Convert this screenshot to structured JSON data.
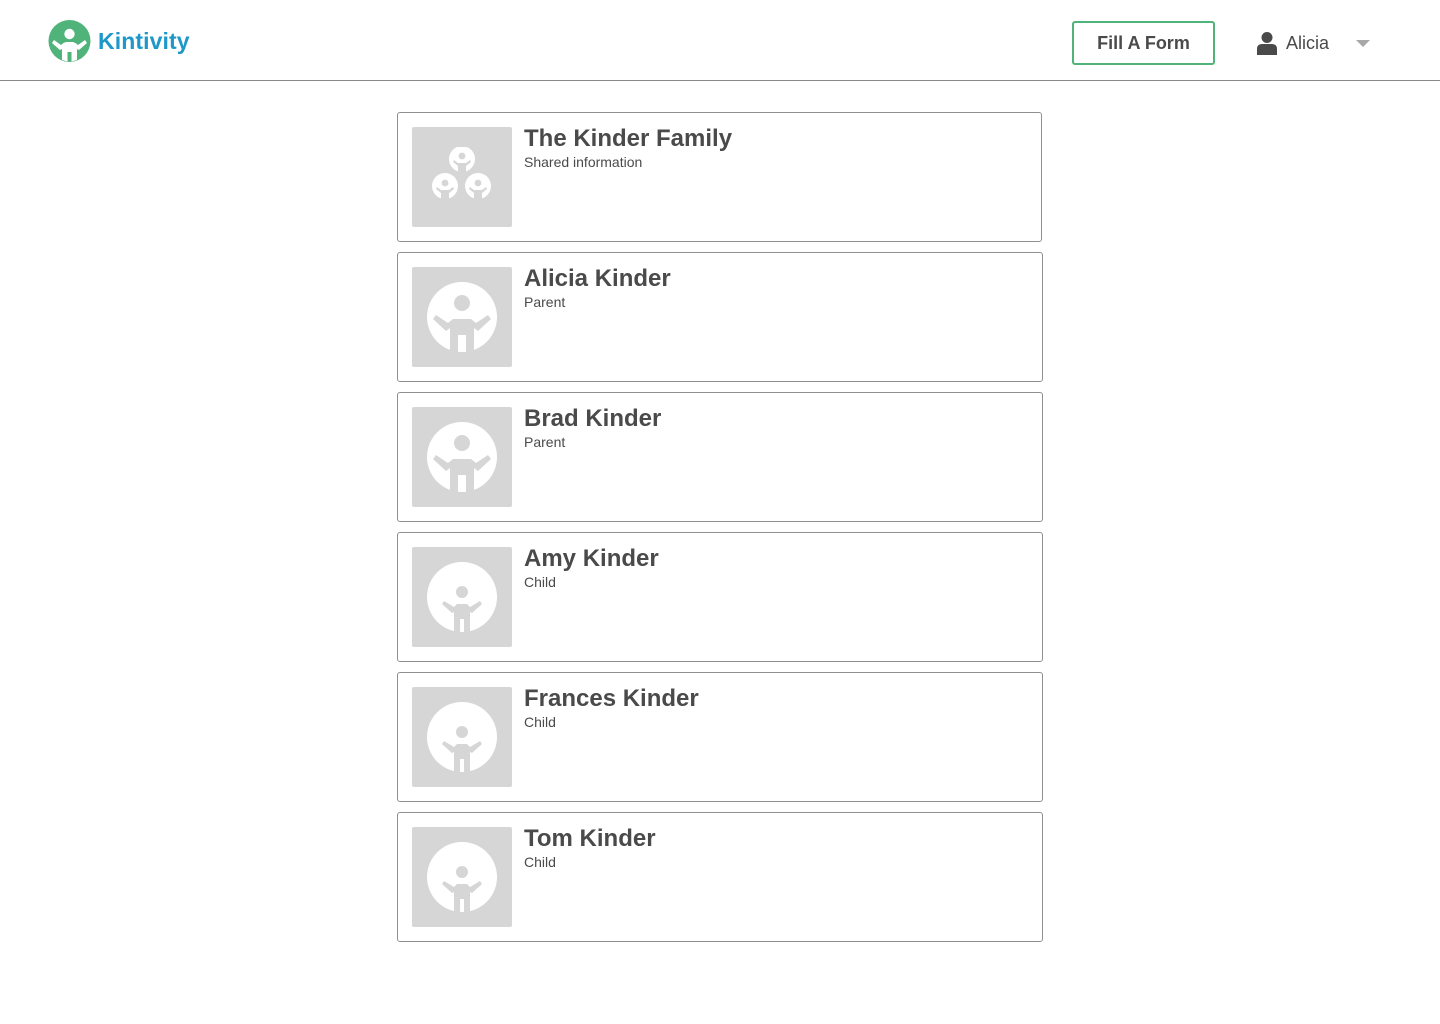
{
  "header": {
    "logo_text": "Kintivity",
    "fill_form_label": "Fill A Form",
    "user_name": "Alicia"
  },
  "colors": {
    "brand_green": "#4fb37a",
    "brand_blue": "#1e97c9",
    "avatar_bg": "#d6d6d6"
  },
  "members": [
    {
      "name": "The Kinder Family",
      "subtitle": "Shared information",
      "icon": "family-icon"
    },
    {
      "name": "Alicia Kinder",
      "subtitle": "Parent",
      "icon": "adult-person-icon"
    },
    {
      "name": "Brad Kinder",
      "subtitle": "Parent",
      "icon": "adult-person-icon"
    },
    {
      "name": "Amy Kinder",
      "subtitle": "Child",
      "icon": "child-person-icon"
    },
    {
      "name": "Frances Kinder",
      "subtitle": "Child",
      "icon": "child-person-icon"
    },
    {
      "name": "Tom Kinder",
      "subtitle": "Child",
      "icon": "child-person-icon"
    }
  ]
}
